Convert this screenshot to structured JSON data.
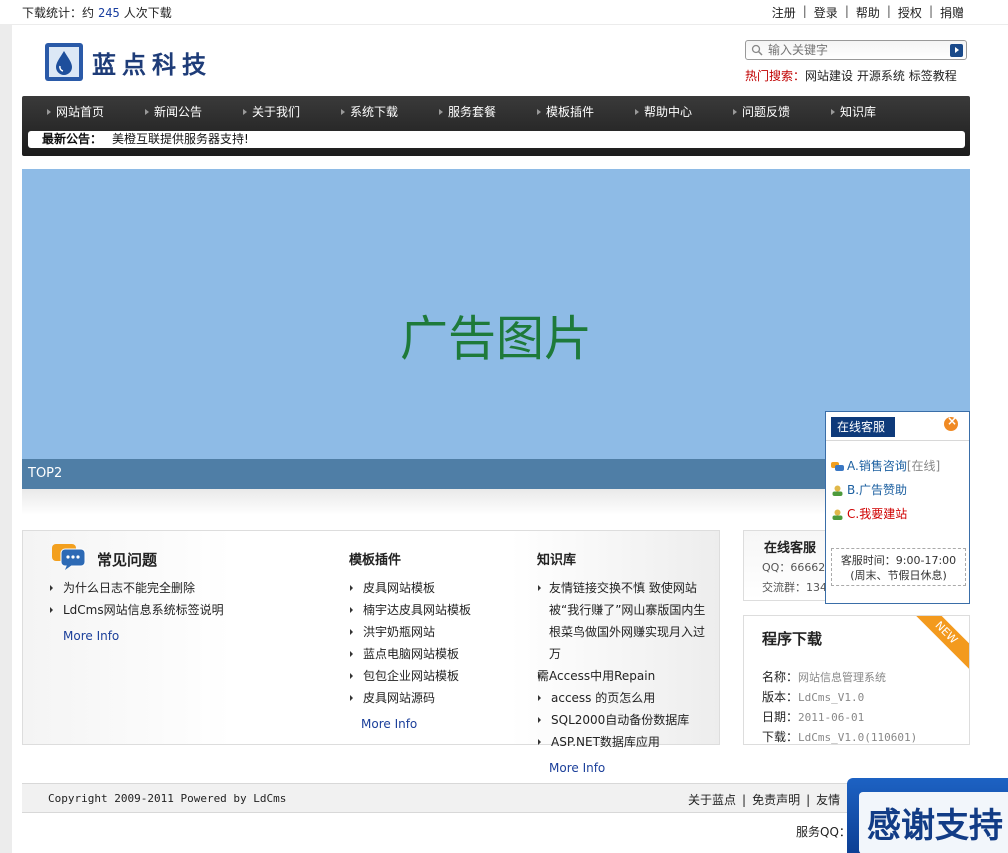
{
  "topbar": {
    "stat_prefix": "下载统计：约",
    "stat_count": "245",
    "stat_suffix": "人次下载",
    "links": [
      "注册",
      "登录",
      "帮助",
      "授权",
      "捐赠"
    ]
  },
  "header": {
    "logo_text": "蓝点科技",
    "search_placeholder": "输入关键字",
    "hot_label": "热门搜索：",
    "hot_keywords": [
      "网站建设",
      "开源系统",
      "标签教程"
    ]
  },
  "nav": {
    "items": [
      "网站首页",
      "新闻公告",
      "关于我们",
      "系统下载",
      "服务套餐",
      "模板插件",
      "帮助中心",
      "问题反馈",
      "知识库"
    ],
    "notice_label": "最新公告：",
    "notice_text": "美橙互联提供服务器支持!"
  },
  "banner": {
    "ad_text": "广告图片",
    "caption": "TOP2"
  },
  "faq": {
    "title": "常见问题",
    "items": [
      "为什么日志不能完全删除",
      "LdCms网站信息系统标签说明"
    ],
    "more": "More Info"
  },
  "plugins": {
    "title": "模板插件",
    "items": [
      "皮具网站模板",
      "楠宇达皮具网站模板",
      "洪宇奶瓶网站",
      "蓝点电脑网站模板",
      "包包企业网站模板",
      "皮具网站源码"
    ],
    "more": "More Info"
  },
  "kb": {
    "title": "知识库",
    "items": [
      "友情链接交换不慎 致使网站被“我行赚了”网山寨版国内生根菜鸟做国外网赚实现月入过万",
      "需Access中用Repain",
      "access 的页怎么用",
      "SQL2000自动备份数据库",
      "ASP.NET数据库应用"
    ],
    "more": "More Info"
  },
  "service_panel": {
    "title": "在线客服",
    "qq": "QQ：6666296",
    "group": "交流群：134"
  },
  "download": {
    "title": "程序下载",
    "badge": "NEW",
    "rows": [
      {
        "label": "名称：",
        "value": "网站信息管理系统"
      },
      {
        "label": "版本：",
        "value": "LdCms_V1.0"
      },
      {
        "label": "日期：",
        "value": "2011-06-01"
      },
      {
        "label": "下载：",
        "value": "LdCms_V1.0(110601)"
      }
    ]
  },
  "footer": {
    "copyright": "Copyright 2009-2011 Powered by LdCms",
    "links": [
      "关于蓝点",
      "免责声明",
      "友情"
    ],
    "service_qq": "服务QQ：6"
  },
  "popup": {
    "title": "在线客服",
    "entries": [
      {
        "label": "A.销售咨询",
        "status": "[在线]"
      },
      {
        "label": "B.广告赞助",
        "status": ""
      },
      {
        "label": "C.我要建站",
        "status": ""
      }
    ],
    "hours_line1": "客服时间：9:00-17:00",
    "hours_line2": "(周末、节假日休息)"
  },
  "thanks_badge": {
    "text": "感谢支持"
  },
  "colors": {
    "nav_bg": "#1c1c1c",
    "banner_bg": "#8ebbe6",
    "banner_caption_bg": "#4f7ea6",
    "ad_text": "#1e7a3a",
    "link_blue": "#1b3f9a",
    "hot_red": "#c00000",
    "popup_border": "#3a6ea8"
  }
}
